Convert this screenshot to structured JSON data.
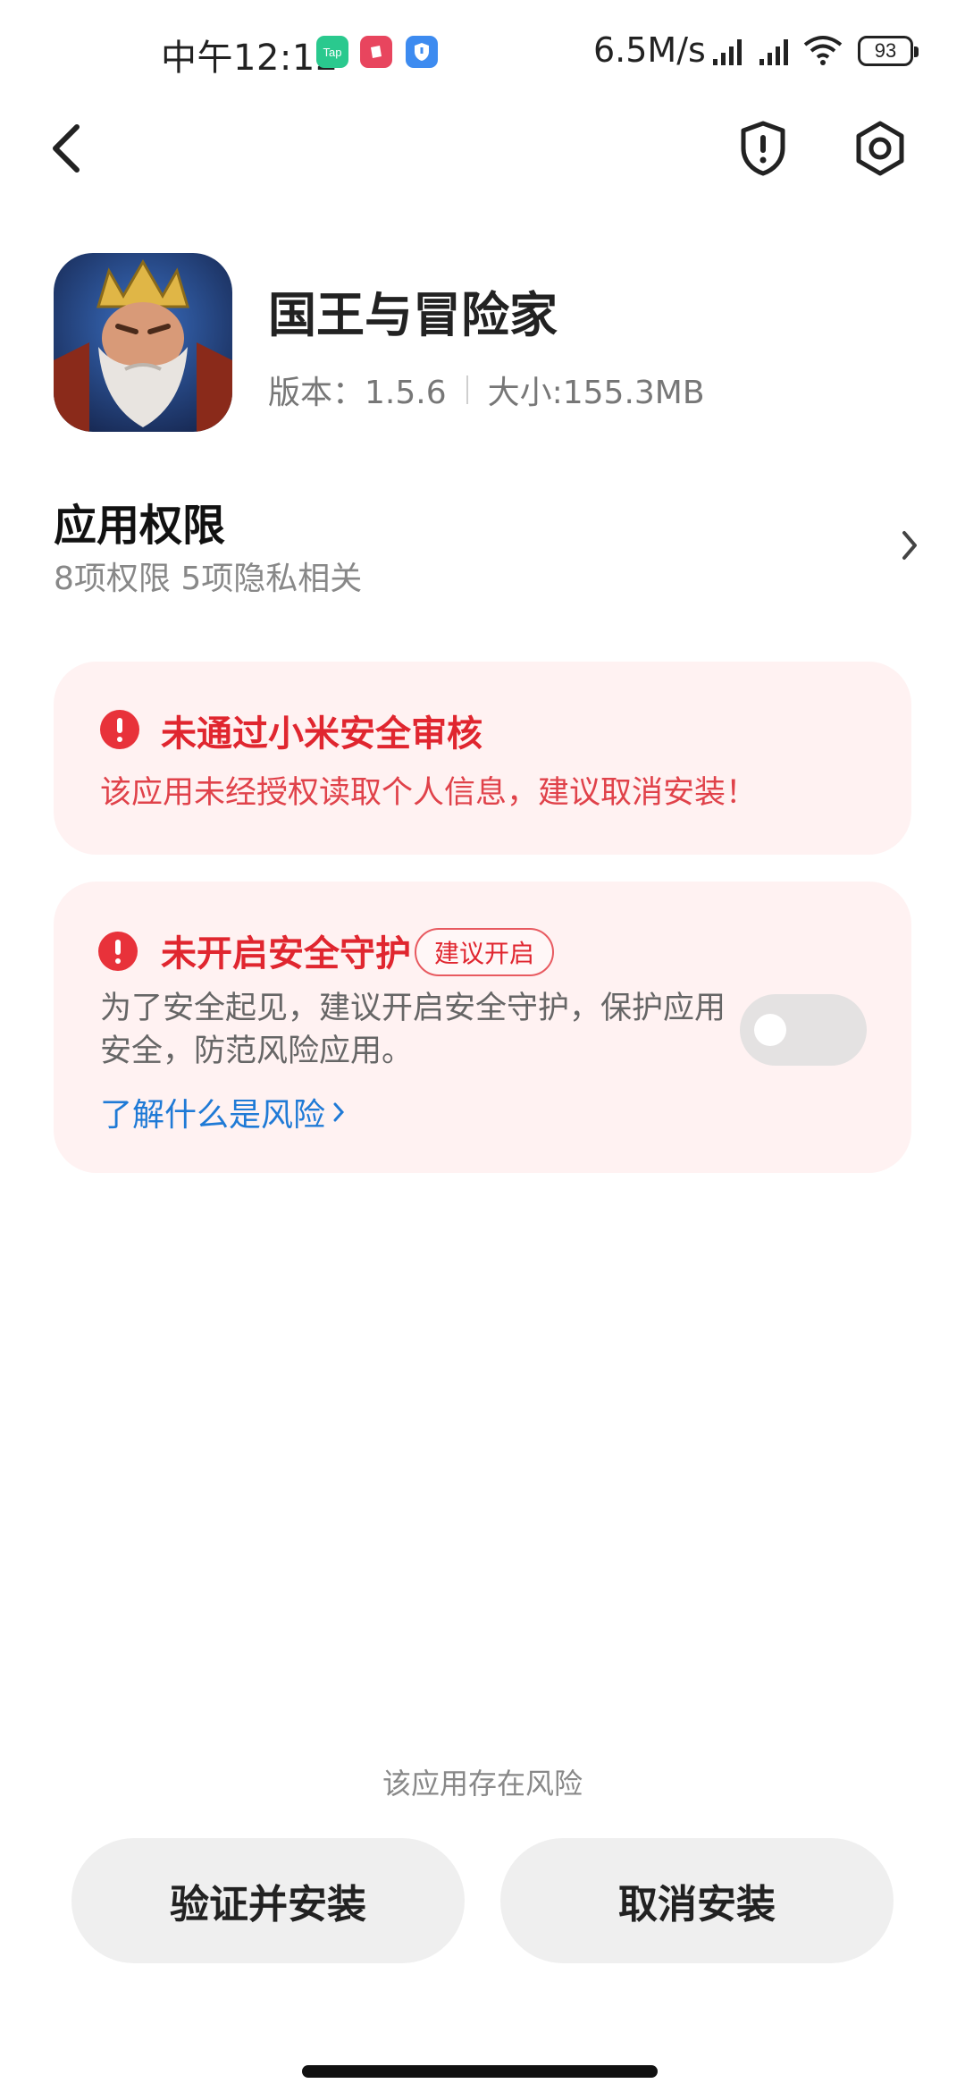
{
  "status_bar": {
    "time": "中午12:12",
    "apps": [
      "Tap",
      "",
      ""
    ],
    "net_speed": "6.5M/s",
    "battery": "93"
  },
  "header": {
    "back_icon": "chevron-left-icon",
    "shield_icon": "shield-alert-icon",
    "settings_icon": "settings-hexagon-icon"
  },
  "app": {
    "name": "国王与冒险家",
    "version_label": "版本：1.5.6",
    "size_label": "大小:155.3MB"
  },
  "permissions": {
    "title": "应用权限",
    "summary": "8项权限 5项隐私相关"
  },
  "audit_card": {
    "title": "未通过小米安全审核",
    "description": "该应用未经授权读取个人信息，建议取消安装！"
  },
  "protect_card": {
    "title": "未开启安全守护",
    "badge": "建议开启",
    "description": "为了安全起见，建议开启安全守护，保护应用安全，防范风险应用。",
    "link": "了解什么是风险",
    "toggle_on": false
  },
  "footer": {
    "risk_note": "该应用存在风险",
    "verify_install": "验证并安装",
    "cancel_install": "取消安装"
  },
  "colors": {
    "danger": "#e0262f",
    "card_bg": "#fff2f2",
    "link": "#1f7ad6"
  }
}
